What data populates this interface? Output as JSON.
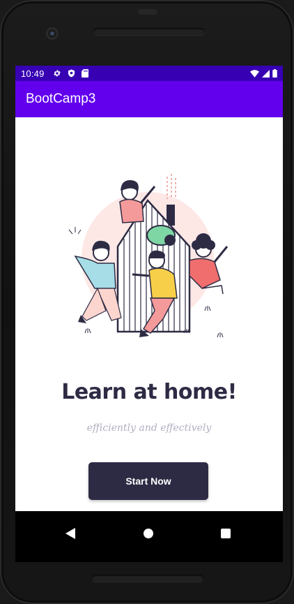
{
  "status_bar": {
    "time": "10:49",
    "left_icons": [
      "gear-icon",
      "shield-icon",
      "sd-card-icon"
    ],
    "right_icons": [
      "wifi-icon",
      "signal-icon",
      "battery-icon"
    ]
  },
  "app_bar": {
    "title": "BootCamp3",
    "color": "#6200ee",
    "status_color": "#3700b3"
  },
  "main": {
    "illustration": "people-playing-in-house-illustration",
    "headline": "Learn at home!",
    "subtitle": "efficiently and effectively",
    "start_button_label": "Start Now",
    "accent_color": "#2d2b44"
  },
  "nav_bar": {
    "icons": [
      "back-icon",
      "home-icon",
      "recents-icon"
    ]
  }
}
